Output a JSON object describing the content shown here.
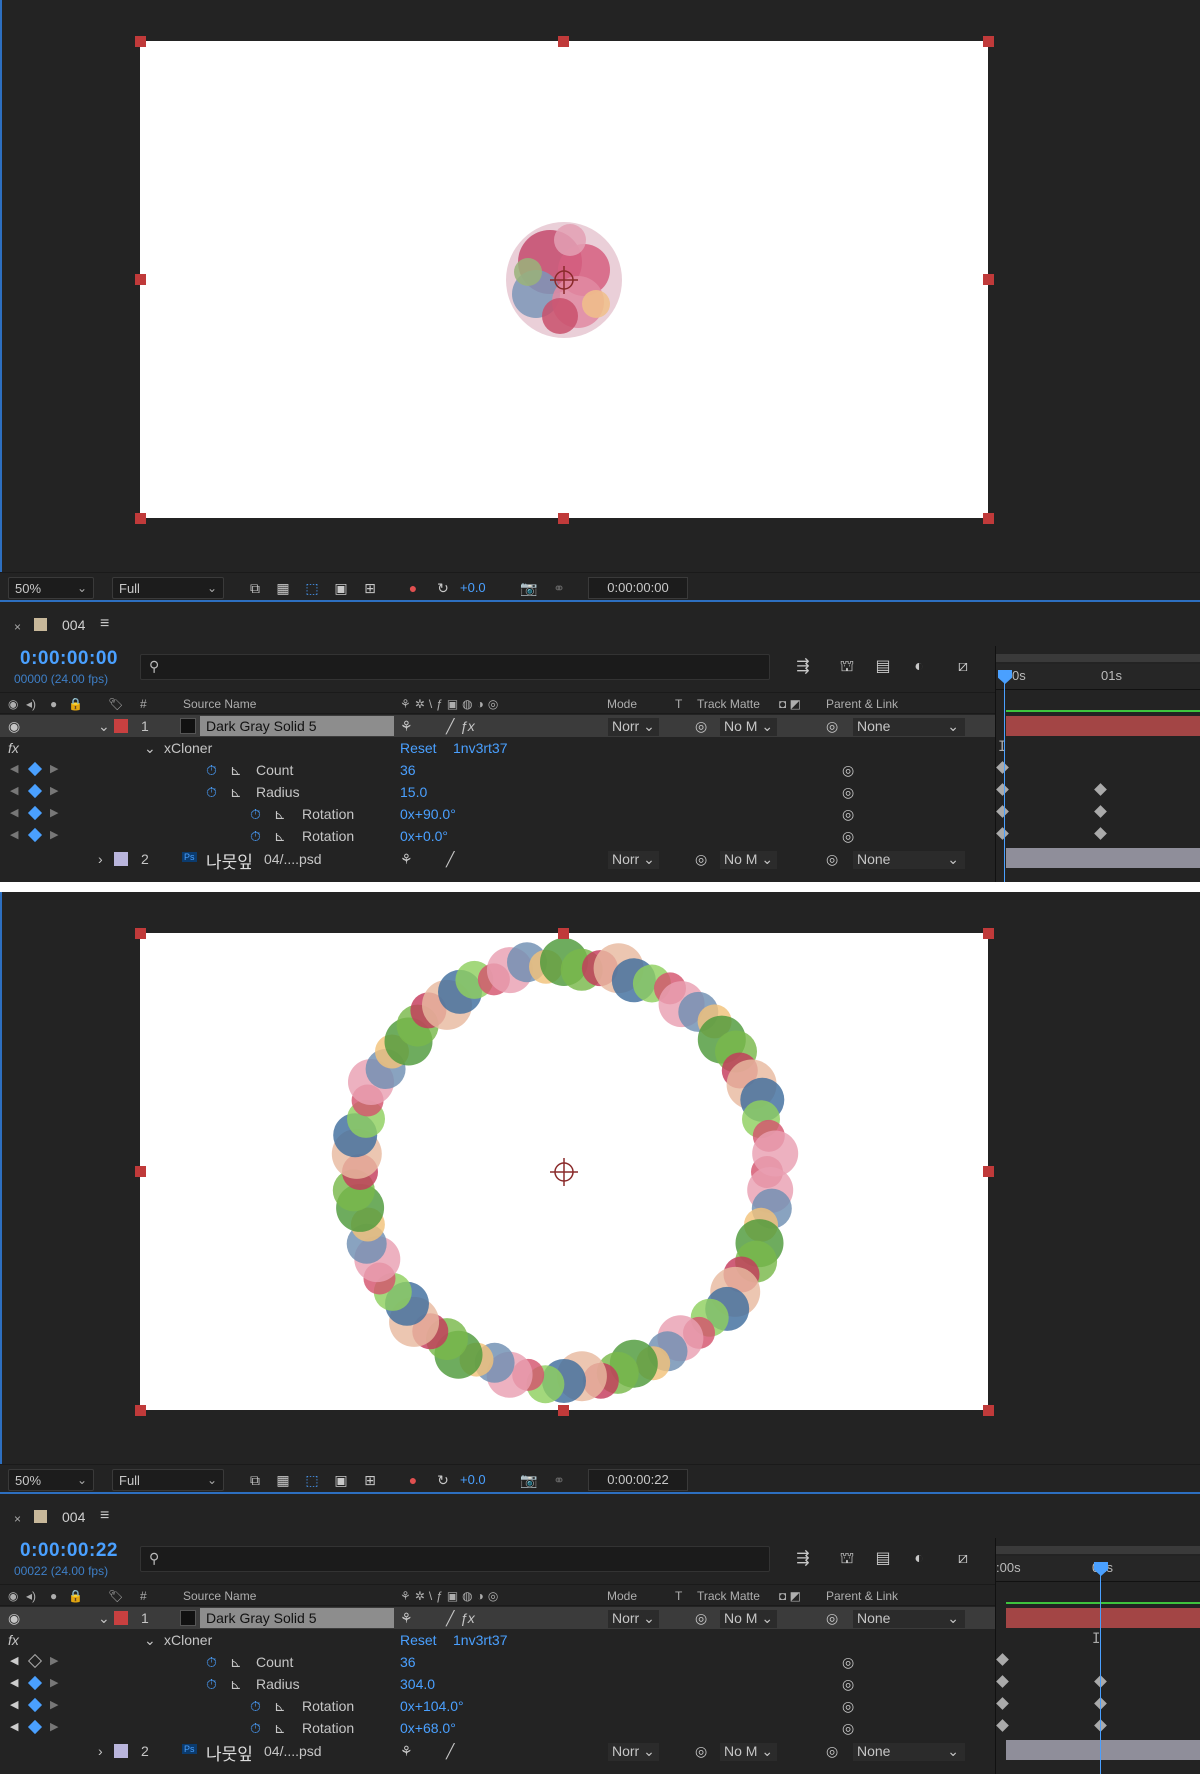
{
  "panels": [
    {
      "viewer": {
        "zoom": "50%",
        "resolution": "Full",
        "exposure": "+0.0",
        "timecode": "0:00:00:00",
        "artwork": "small-flower-cluster"
      },
      "timeline": {
        "comp_name": "004",
        "current_time": "0:00:00:00",
        "frames": "00000 (24.00 fps)",
        "ruler": [
          "0s",
          "01s"
        ],
        "columns": {
          "num": "#",
          "source_name": "Source Name",
          "mode": "Mode",
          "t": "T",
          "track_matte": "Track Matte",
          "parent": "Parent & Link"
        },
        "layer1": {
          "index": "1",
          "name": "Dark Gray Solid 5",
          "mode": "Norr",
          "matte": "No M",
          "parent": "None",
          "color": "#c84040"
        },
        "effect": {
          "fx": "fx",
          "name": "xCloner",
          "reset": "Reset",
          "preset": "1nv3rt37"
        },
        "props": [
          {
            "name": "Count",
            "value": "36"
          },
          {
            "name": "Radius",
            "value": "15.0"
          },
          {
            "name": "Rotation",
            "value": "0x+90.0°"
          },
          {
            "name": "Rotation",
            "value": "0x+0.0°"
          }
        ],
        "layer2": {
          "index": "2",
          "badge": "Ps",
          "name_prefix": "나뭇잎",
          "name": "04/....psd",
          "mode": "Norr",
          "matte": "No M",
          "parent": "None",
          "color": "#b9b5dc"
        }
      }
    },
    {
      "viewer": {
        "zoom": "50%",
        "resolution": "Full",
        "exposure": "+0.0",
        "timecode": "0:00:00:22",
        "artwork": "flower-wreath-ring"
      },
      "timeline": {
        "comp_name": "004",
        "current_time": "0:00:00:22",
        "frames": "00022 (24.00 fps)",
        "ruler": [
          ":00s",
          "01s"
        ],
        "columns": {
          "num": "#",
          "source_name": "Source Name",
          "mode": "Mode",
          "t": "T",
          "track_matte": "Track Matte",
          "parent": "Parent & Link"
        },
        "layer1": {
          "index": "1",
          "name": "Dark Gray Solid 5",
          "mode": "Norr",
          "matte": "No M",
          "parent": "None",
          "color": "#c84040"
        },
        "effect": {
          "fx": "fx",
          "name": "xCloner",
          "reset": "Reset",
          "preset": "1nv3rt37"
        },
        "props": [
          {
            "name": "Count",
            "value": "36"
          },
          {
            "name": "Radius",
            "value": "304.0"
          },
          {
            "name": "Rotation",
            "value": "0x+104.0°"
          },
          {
            "name": "Rotation",
            "value": "0x+68.0°"
          }
        ],
        "layer2": {
          "index": "2",
          "badge": "Ps",
          "name_prefix": "나뭇잎",
          "name": "04/....psd",
          "mode": "Norr",
          "matte": "No M",
          "parent": "None",
          "color": "#b9b5dc"
        }
      }
    }
  ],
  "colors": {
    "accent": "#4aa0ff",
    "handle": "#c03a3a",
    "layer_bar": "#a34545",
    "panel_bg": "#232323"
  }
}
